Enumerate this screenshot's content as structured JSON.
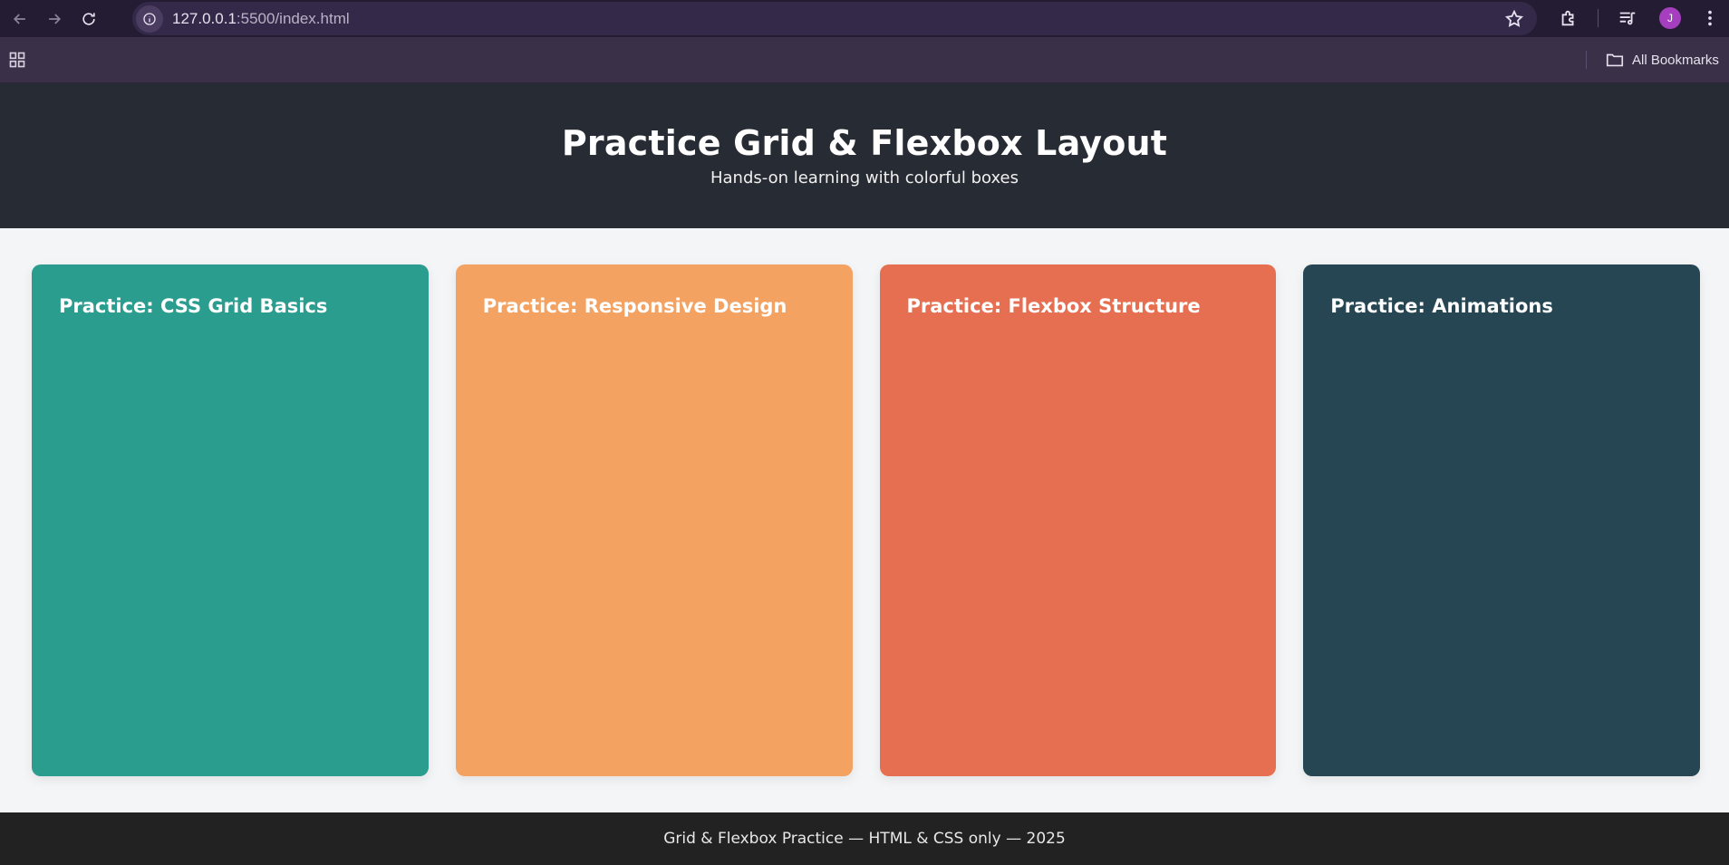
{
  "browser": {
    "url_host": "127.0.0.1",
    "url_rest": ":5500/index.html",
    "avatar_letter": "J",
    "bookmarks_label": "All Bookmarks"
  },
  "header": {
    "title": "Practice Grid & Flexbox Layout",
    "subtitle": "Hands-on learning with colorful boxes"
  },
  "cards": [
    {
      "title": "Practice: CSS Grid Basics",
      "color": "#2a9d8f"
    },
    {
      "title": "Practice: Responsive Design",
      "color": "#f4a261"
    },
    {
      "title": "Practice: Flexbox Structure",
      "color": "#e76f51"
    },
    {
      "title": "Practice: Animations",
      "color": "#264653"
    }
  ],
  "footer": {
    "text": "Grid & Flexbox Practice — HTML & CSS only — 2025"
  }
}
